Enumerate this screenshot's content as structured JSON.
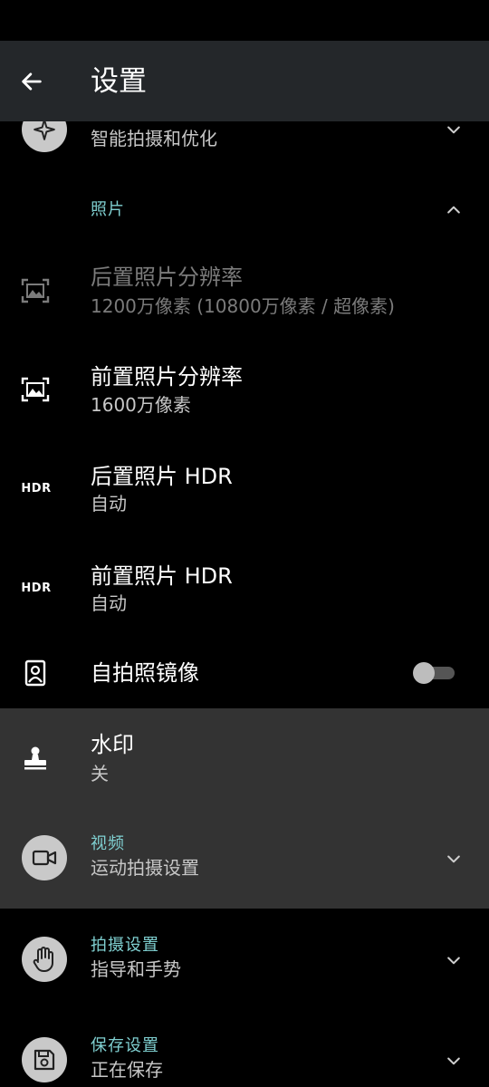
{
  "header": {
    "title": "设置"
  },
  "sections": {
    "smart": {
      "subtitle": "智能拍摄和优化",
      "icon": "sparkle-icon"
    },
    "photo": {
      "label": "照片",
      "icon": "chevron-up-icon"
    },
    "video": {
      "title": "视频",
      "subtitle": "运动拍摄设置"
    },
    "capture": {
      "title": "拍摄设置",
      "subtitle": "指导和手势"
    },
    "save": {
      "title": "保存设置",
      "subtitle": "正在保存"
    }
  },
  "photo_settings": [
    {
      "title": "后置照片分辨率",
      "value": "1200万像素 (10800万像素 / 超像素)",
      "enabled": false,
      "icon": "photo-size-icon"
    },
    {
      "title": "前置照片分辨率",
      "value": "1600万像素",
      "enabled": true,
      "icon": "photo-size-icon"
    },
    {
      "title": "后置照片 HDR",
      "value": "自动",
      "icon_text": "HDR"
    },
    {
      "title": "前置照片 HDR",
      "value": "自动",
      "icon_text": "HDR"
    }
  ],
  "mirror": {
    "title": "自拍照镜像",
    "checked": false
  },
  "watermark": {
    "title": "水印",
    "value": "关"
  },
  "colors": {
    "accent": "#7fcfd0",
    "highlight": "#333333",
    "app_bar": "#24272a"
  }
}
